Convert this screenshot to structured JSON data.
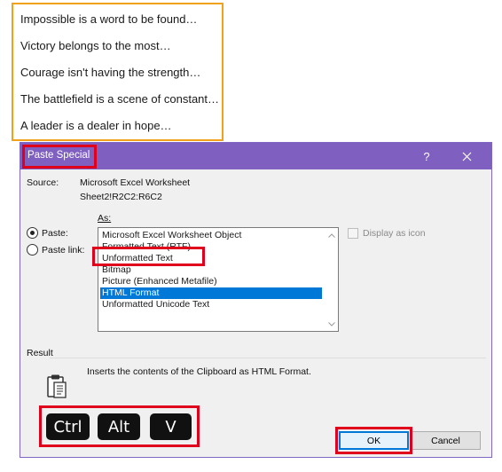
{
  "quotes": [
    "Impossible is a word to be found…",
    "Victory belongs to the most…",
    "Courage isn't having the strength…",
    "The battlefield is a scene of constant…",
    "A leader is a dealer in hope…"
  ],
  "dialog": {
    "title": "Paste Special",
    "help": "?",
    "source_label": "Source:",
    "source_name": "Microsoft Excel Worksheet",
    "source_range": "Sheet2!R2C2:R6C2",
    "as_label": "As:",
    "paste_label": "Paste:",
    "paste_link_label": "Paste link:",
    "paste_checked": true,
    "formats": [
      "Microsoft Excel Worksheet Object",
      "Formatted Text (RTF)",
      "Unformatted Text",
      "Bitmap",
      "Picture (Enhanced Metafile)",
      "HTML Format",
      "Unformatted Unicode Text"
    ],
    "selected_format": "HTML Format",
    "display_as_icon": "Display as icon",
    "result_label": "Result",
    "result_text": "Inserts the contents of the Clipboard as HTML Format.",
    "ok": "OK",
    "cancel": "Cancel"
  },
  "shortcut_keys": [
    "Ctrl",
    "Alt",
    "V"
  ],
  "colors": {
    "title_bar": "#7f5fbf",
    "highlight_red": "#e0001b",
    "quote_border": "#f2a21a",
    "selection": "#0078d7"
  }
}
